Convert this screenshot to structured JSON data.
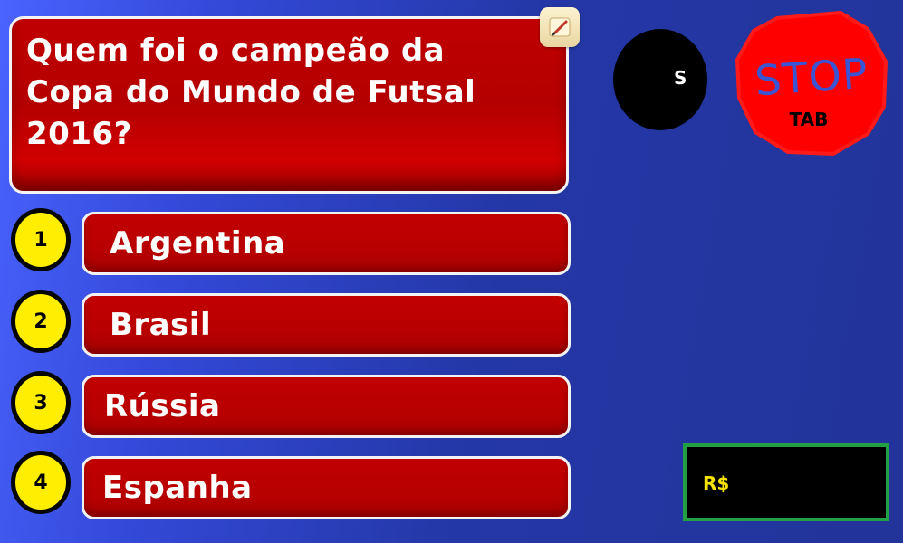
{
  "question": {
    "text": "Quem foi o campeão da Copa do Mundo de Futsal 2016?"
  },
  "answers": [
    {
      "number": "1",
      "label": "Argentina"
    },
    {
      "number": "2",
      "label": "Brasil"
    },
    {
      "number": "3",
      "label": "Rússia"
    },
    {
      "number": "4",
      "label": "Espanha"
    }
  ],
  "timer": {
    "label": "S"
  },
  "stop": {
    "label": "STOP",
    "shortcut": "TAB"
  },
  "prize": {
    "label": "R$"
  },
  "icons": {
    "edit": "edit-pencil-icon",
    "stop": "stop-sign-icon"
  },
  "colors": {
    "background": "#2a3fc0",
    "question_box": "#b80000",
    "answer_circle": "#ffee00",
    "money_border": "#22a043",
    "money_text": "#f5e200"
  }
}
